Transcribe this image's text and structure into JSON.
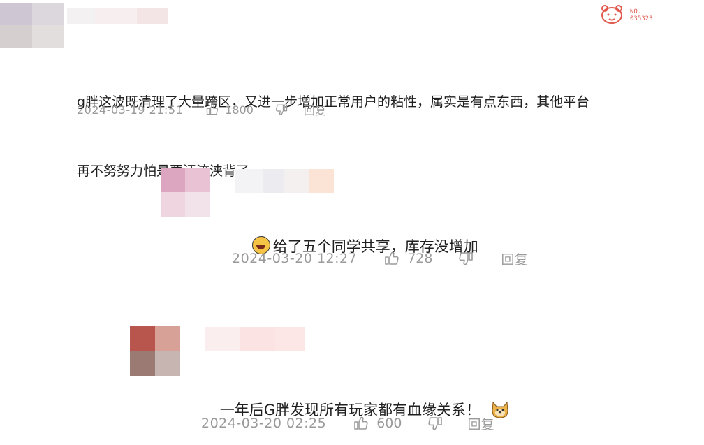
{
  "badge": {
    "label_line1": "NO.",
    "label_line2": "035323",
    "icon": "cartoon-cat-icon"
  },
  "comments": [
    {
      "text_line1": "g胖这波既清理了大量跨区，又进一步增加正常用户的粘性，属实是有点东西，其他平台",
      "text_line2": "再不努努力怕是要汗流浃背了",
      "time": "2024-03-19 21:51",
      "likes": "1800",
      "reply_label": "回复"
    },
    {
      "emoji": "laughing-emoji-icon",
      "text": "给了五个同学共享，库存没增加",
      "time": "2024-03-20 12:27",
      "likes": "728",
      "reply_label": "回复"
    },
    {
      "text": "一年后G胖发现所有玩家都有血缘关系！",
      "emoji": "dog-emoji-icon",
      "time": "2024-03-20 02:25",
      "likes": "600",
      "reply_label": "回复"
    }
  ],
  "colors": {
    "meta_gray": "#9a9a9a",
    "text": "#1f1f1f",
    "badge_red": "#e05a4f"
  }
}
